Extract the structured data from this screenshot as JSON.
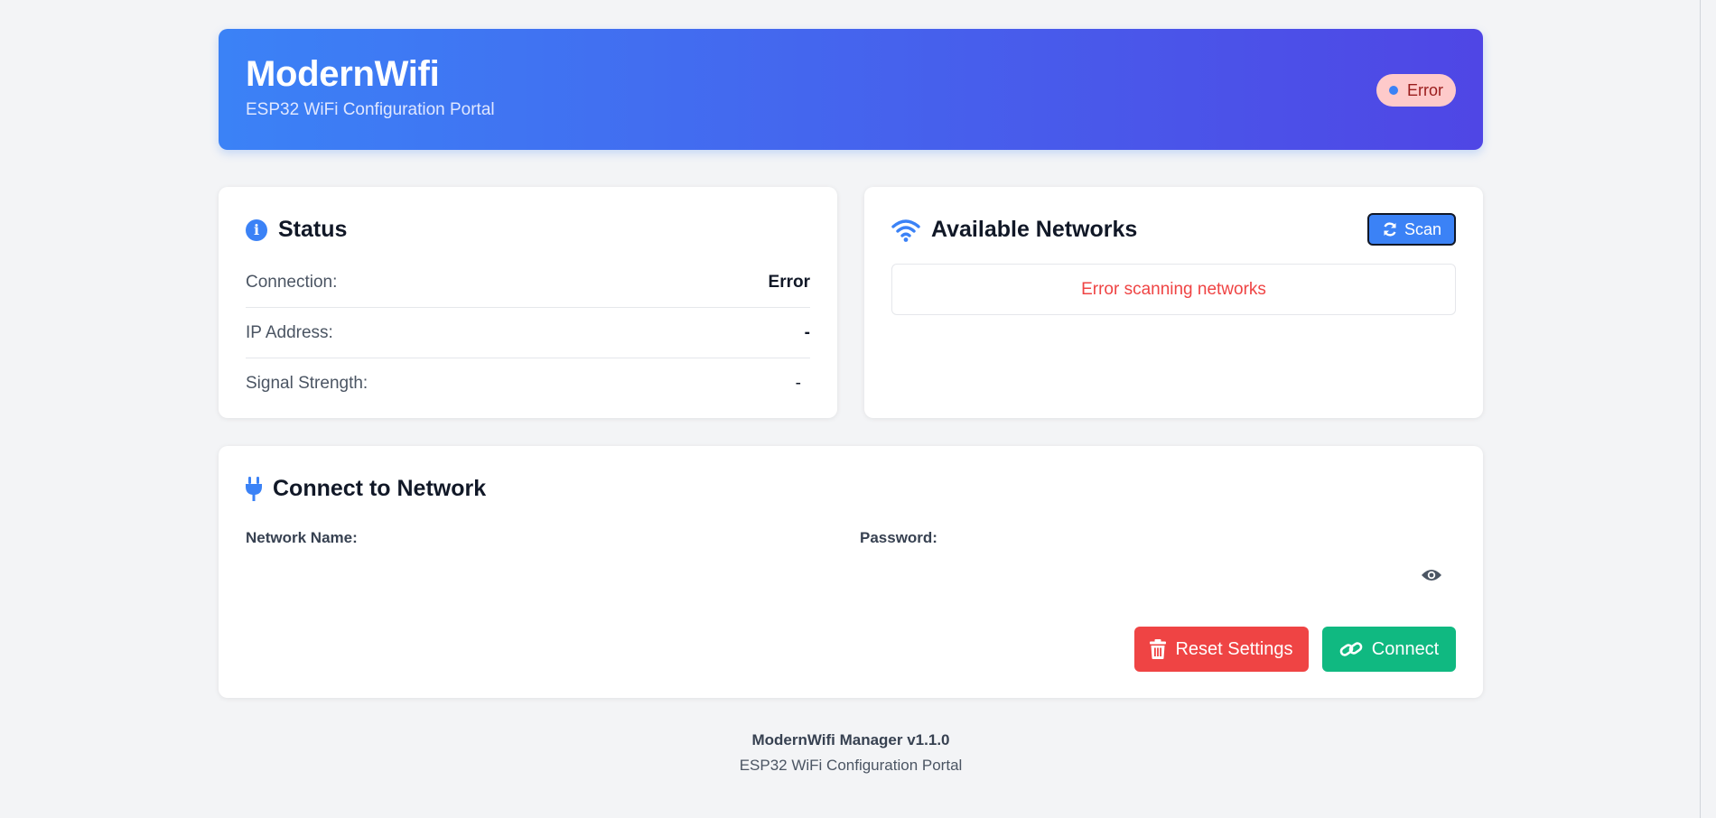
{
  "header": {
    "title": "ModernWifi",
    "subtitle": "ESP32 WiFi Configuration Portal",
    "status_label": "Error"
  },
  "status_card": {
    "title": "Status",
    "icon": "info-icon",
    "rows": [
      {
        "label": "Connection:",
        "value": "Error"
      },
      {
        "label": "IP Address:",
        "value": "-"
      },
      {
        "label": "Signal Strength:",
        "value": "-"
      }
    ]
  },
  "networks_card": {
    "title": "Available Networks",
    "icon": "wifi-icon",
    "scan_label": "Scan",
    "message": "Error scanning networks"
  },
  "connect_card": {
    "title": "Connect to Network",
    "icon": "plug-icon",
    "network_label": "Network Name:",
    "network_value": "",
    "password_label": "Password:",
    "password_value": "",
    "reset_label": "Reset Settings",
    "connect_label": "Connect"
  },
  "footer": {
    "title": "ModernWifi Manager v1.1.0",
    "subtitle": "ESP32 WiFi Configuration Portal"
  },
  "colors": {
    "primary": "#3b82f6",
    "header_gradient_end": "#4f46e5",
    "error": "#ef4444",
    "success": "#10b981",
    "background": "#f3f4f6"
  }
}
